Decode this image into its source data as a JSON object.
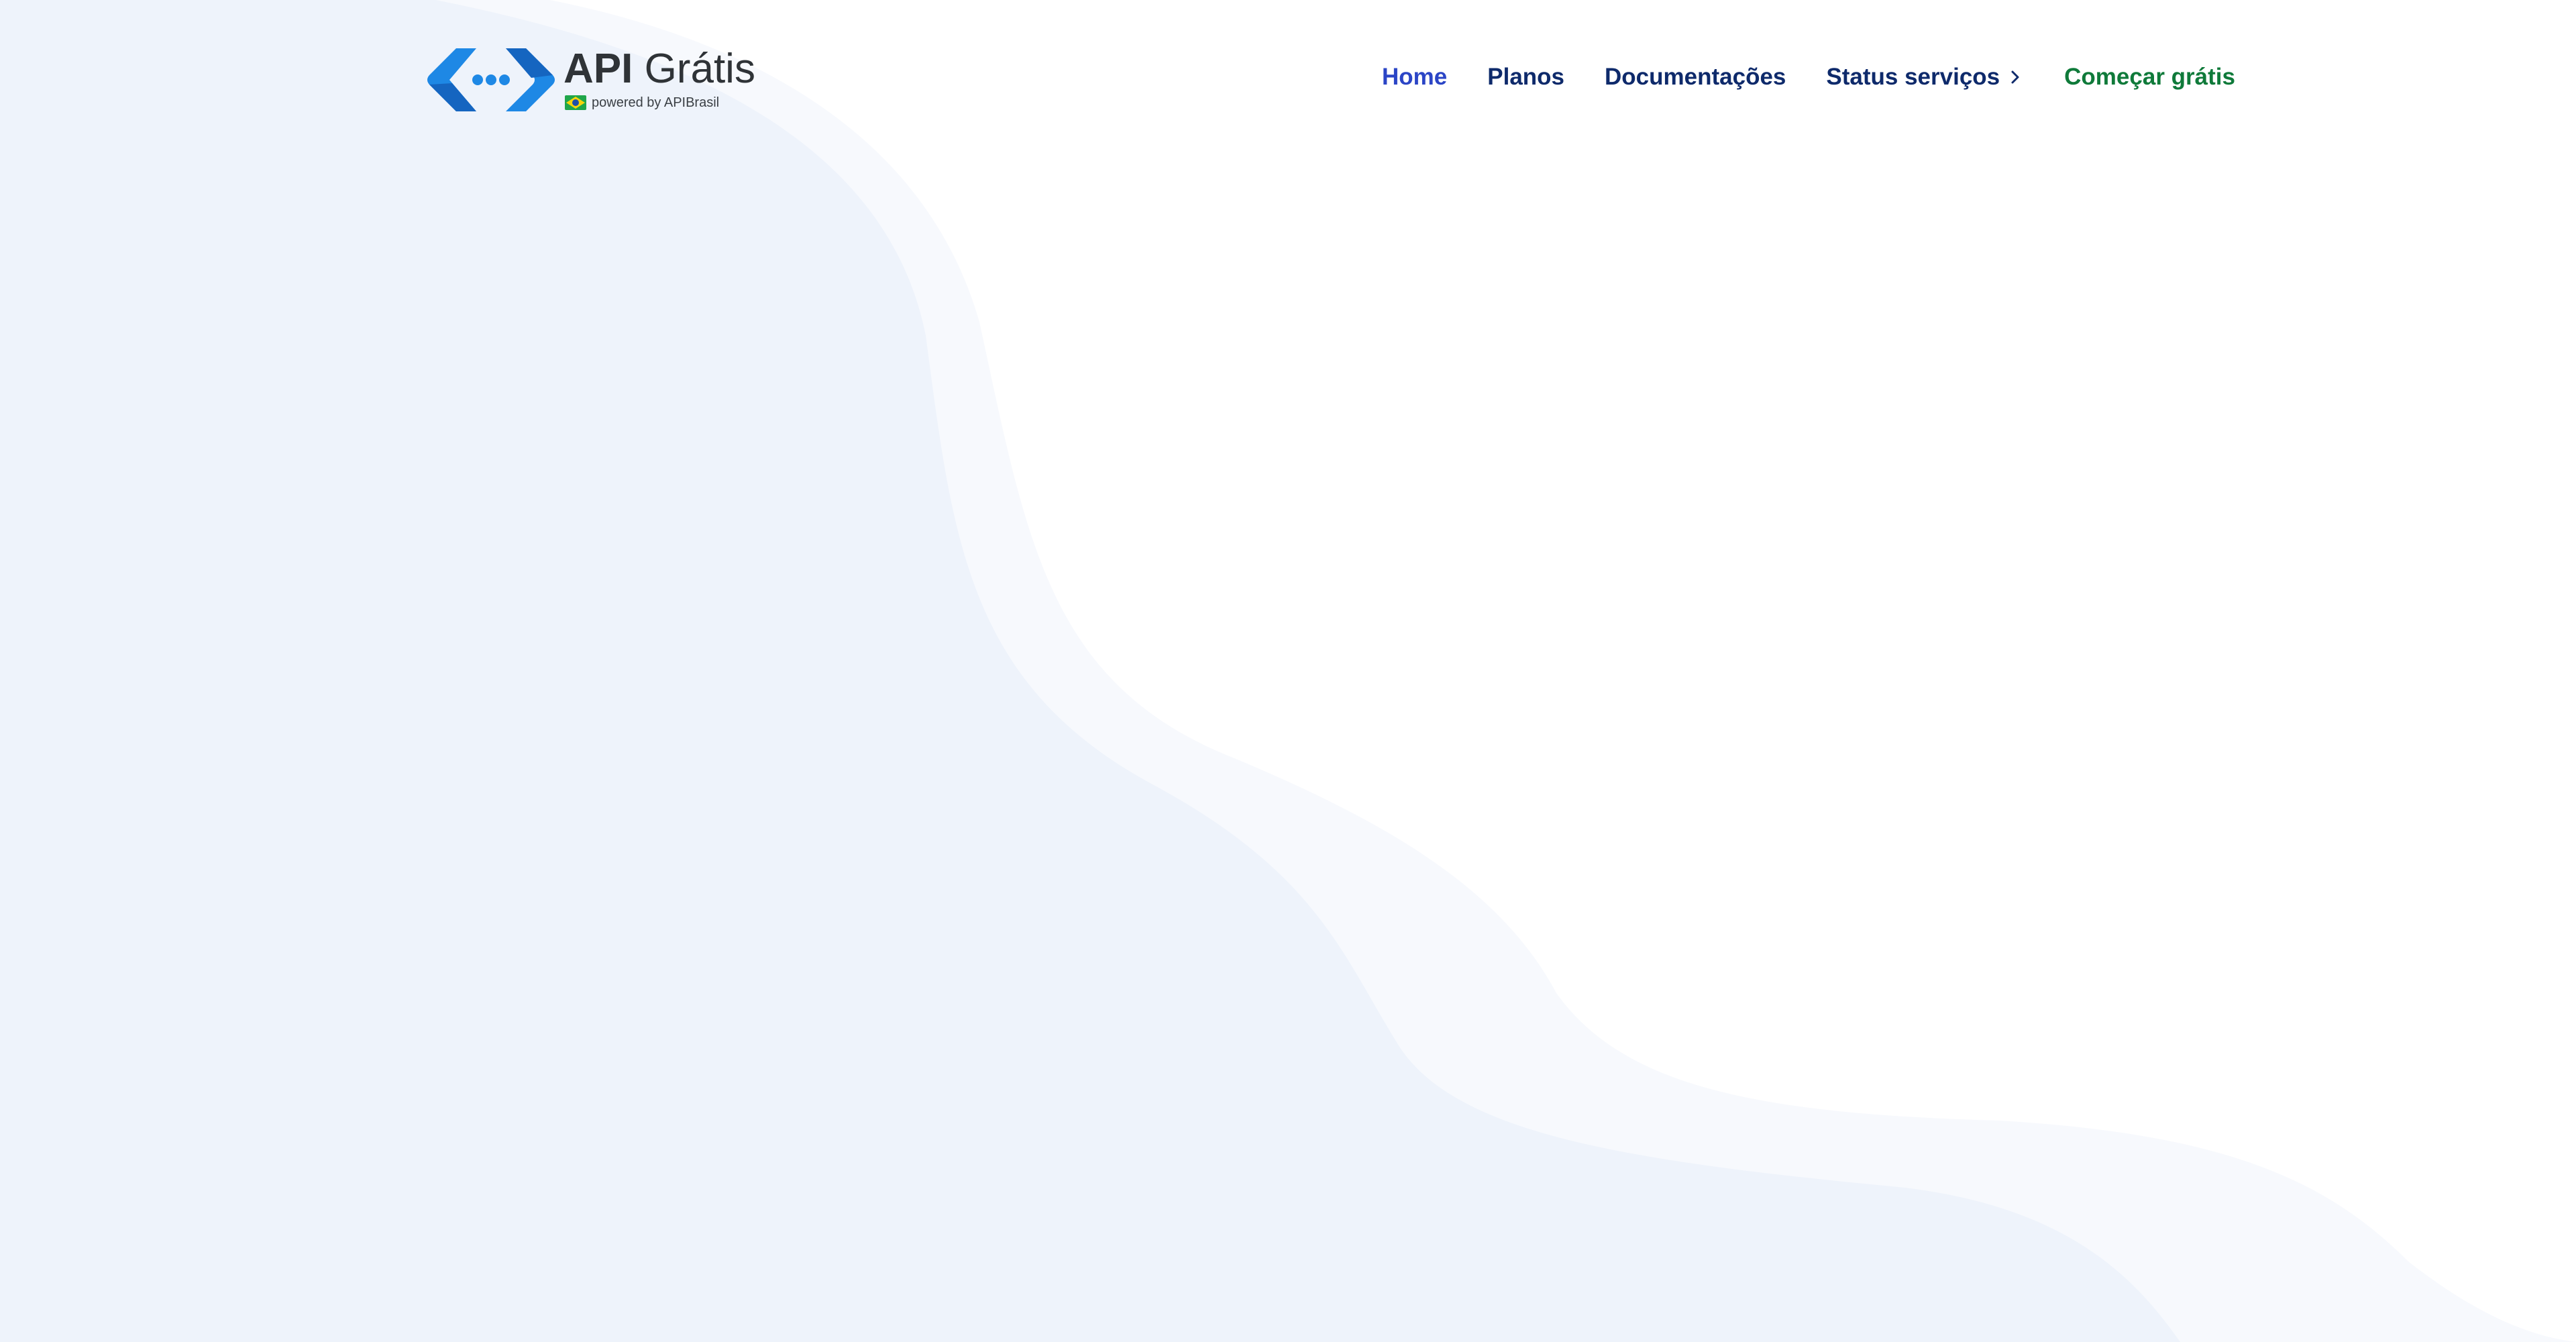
{
  "logo": {
    "title_api": "API",
    "title_gratis": " Grátis",
    "powered": "powered by APIBrasil"
  },
  "nav": {
    "home": "Home",
    "planos": "Planos",
    "documentacoes": "Documentações",
    "status_servicos": "Status serviços",
    "comecar_gratis": "Começar grátis"
  },
  "colors": {
    "nav_text": "#0e2a6b",
    "nav_active": "#2b45c6",
    "cta": "#0f7a3a",
    "logo_blue": "#1e88e5",
    "logo_blue_dark": "#1565c0",
    "wave_light": "#f7f9fd",
    "wave_mid": "#eef3fb"
  },
  "icons": {
    "logo_mark": "code-arrows-logo-icon",
    "flag": "brazil-flag-icon",
    "status_chevron": "chevron-right-icon"
  }
}
